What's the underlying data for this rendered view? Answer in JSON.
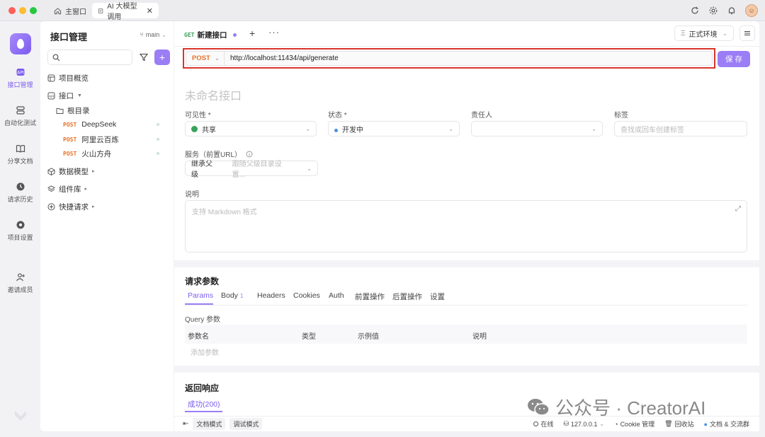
{
  "window": {
    "tabs": [
      {
        "label": "主窗口"
      },
      {
        "label": "AI 大模型调用"
      }
    ]
  },
  "rail": {
    "items": [
      {
        "label": "接口管理",
        "icon": "api-icon",
        "active": true
      },
      {
        "label": "自动化测试",
        "icon": "automation-icon"
      },
      {
        "label": "分享文档",
        "icon": "book-icon"
      },
      {
        "label": "请求历史",
        "icon": "clock-icon"
      },
      {
        "label": "项目设置",
        "icon": "settings-icon"
      },
      {
        "label": "邀请成员",
        "icon": "invite-user-icon"
      }
    ]
  },
  "sidebar": {
    "title": "接口管理",
    "branch": "main",
    "overview": "项目概览",
    "interfaces": "接口",
    "root": "根目录",
    "endpoints": [
      {
        "method": "POST",
        "name": "DeepSeek"
      },
      {
        "method": "POST",
        "name": "阿里云百炼"
      },
      {
        "method": "POST",
        "name": "火山方舟"
      }
    ],
    "data_models": "数据模型",
    "components": "组件库",
    "quick_requests": "快捷请求"
  },
  "main": {
    "tab": {
      "method": "GET",
      "label": "新建接口"
    },
    "environment": "正式环境",
    "request": {
      "method": "POST",
      "url": "http://localhost:11434/api/generate",
      "save_label": "保 存"
    },
    "name_placeholder": "未命名接口",
    "fields": {
      "visibility_label": "可见性 *",
      "visibility_value": "共享",
      "status_label": "状态 *",
      "status_value": "开发中",
      "owner_label": "责任人",
      "tags_label": "标签",
      "tags_placeholder": "查找或回车创建标签",
      "service_label": "服务（前置URL）",
      "service_value": "继承父级",
      "service_hint": "跟随父级目录设置...",
      "description_label": "说明",
      "description_placeholder": "支持 Markdown 格式"
    },
    "params": {
      "title": "请求参数",
      "tabs": [
        "Params",
        "Body",
        "Headers",
        "Cookies",
        "Auth",
        "前置操作",
        "后置操作",
        "设置"
      ],
      "body_count": "1",
      "query_label": "Query 参数",
      "columns": [
        "参数名",
        "类型",
        "示例值",
        "说明"
      ],
      "add_placeholder": "添加参数"
    },
    "response": {
      "title": "返回响应",
      "tab": "成功(200)"
    }
  },
  "statusbar": {
    "doc_mode": "文档模式",
    "debug_mode": "调试模式",
    "online": "在线",
    "host": "127.0.0.1",
    "cookie": "Cookie 管理",
    "trash": "回收站",
    "docs": "文档 & 交流群"
  },
  "watermark": {
    "text": "公众号 · CreatorAI"
  },
  "colors": {
    "accent": "#9b7ef5",
    "post": "#e8722a",
    "get": "#3aa15a",
    "highlight_border": "#d9342b"
  }
}
